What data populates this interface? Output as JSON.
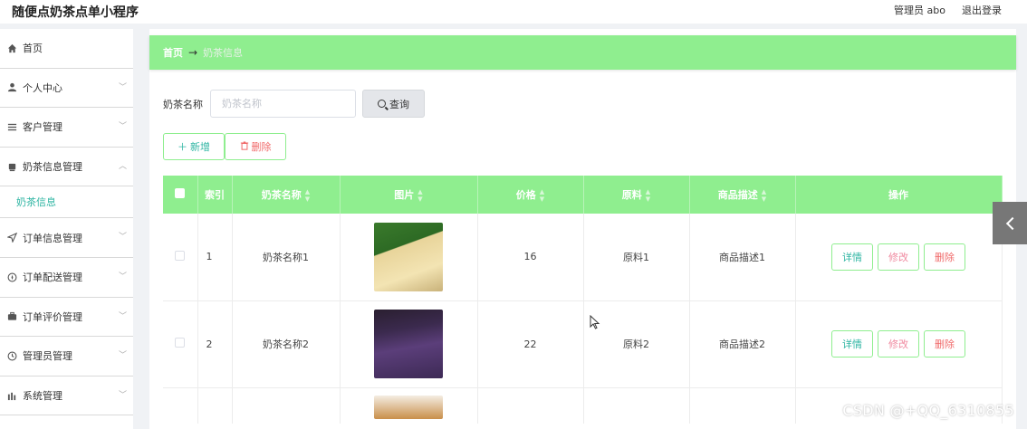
{
  "header": {
    "app_title": "随便点奶茶点单小程序",
    "admin_label": "管理员 abo",
    "logout_label": "退出登录"
  },
  "sidebar": {
    "items": [
      {
        "label": "首页",
        "icon": "home-icon",
        "chevron": false
      },
      {
        "label": "个人中心",
        "icon": "user-icon",
        "chevron": true
      },
      {
        "label": "客户管理",
        "icon": "list-icon",
        "chevron": true
      },
      {
        "label": "奶茶信息管理",
        "icon": "cup-icon",
        "chevron": true,
        "expanded": true
      },
      {
        "label": "订单信息管理",
        "icon": "send-icon",
        "chevron": true
      },
      {
        "label": "订单配送管理",
        "icon": "compass-icon",
        "chevron": true
      },
      {
        "label": "订单评价管理",
        "icon": "briefcase-icon",
        "chevron": true
      },
      {
        "label": "管理员管理",
        "icon": "clock-icon",
        "chevron": true
      },
      {
        "label": "系统管理",
        "icon": "chart-icon",
        "chevron": true
      }
    ],
    "active_sub": "奶茶信息"
  },
  "breadcrumb": {
    "home": "首页",
    "current": "奶茶信息"
  },
  "search": {
    "label": "奶茶名称",
    "placeholder": "奶茶名称",
    "value": "",
    "button_label": "查询"
  },
  "actions": {
    "add_label": "新增",
    "delete_label": "删除"
  },
  "table": {
    "columns": [
      "索引",
      "奶茶名称",
      "图片",
      "价格",
      "原料",
      "商品描述",
      "操作"
    ],
    "rows": [
      {
        "index": "1",
        "name": "奶茶名称1",
        "price": "16",
        "ingredient": "原料1",
        "description": "商品描述1"
      },
      {
        "index": "2",
        "name": "奶茶名称2",
        "price": "22",
        "ingredient": "原料2",
        "description": "商品描述2"
      }
    ],
    "op_labels": {
      "detail": "详情",
      "edit": "修改",
      "delete": "删除"
    }
  },
  "colors": {
    "accent_green": "#8fee8f",
    "teal_text": "#2fb5a3",
    "danger": "#f06a6a"
  },
  "watermark": "CSDN @+QQ_6310855"
}
